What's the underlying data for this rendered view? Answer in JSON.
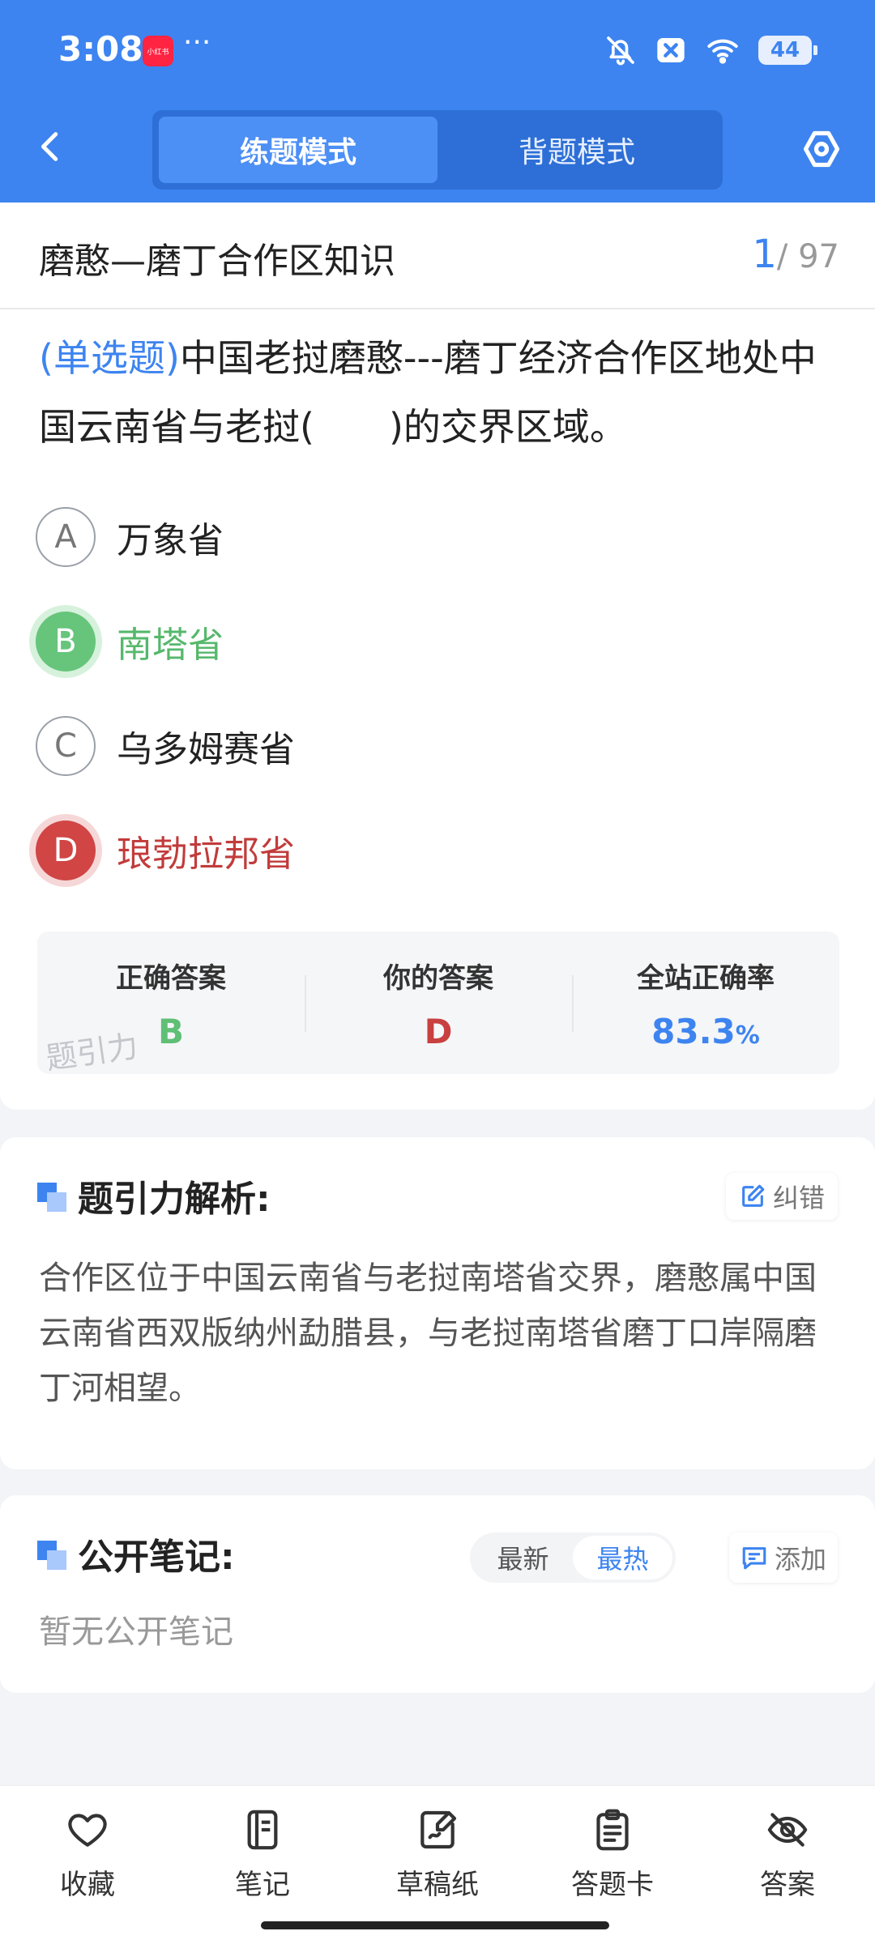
{
  "status": {
    "time": "3:08",
    "app_badge": "小红书",
    "more": "···",
    "battery": "44"
  },
  "header": {
    "tabs": [
      {
        "label": "练题模式",
        "active": true
      },
      {
        "label": "背题模式",
        "active": false
      }
    ]
  },
  "question": {
    "section_title": "磨憨—磨丁合作区知识",
    "progress_current": "1",
    "progress_total": "/ 97",
    "type_label": "(单选题)",
    "text": "中国老挝磨憨---磨丁经济合作区地处中国云南省与老挝(　　)的交界区域。",
    "options": [
      {
        "letter": "A",
        "text": "万象省",
        "state": "normal"
      },
      {
        "letter": "B",
        "text": "南塔省",
        "state": "correct"
      },
      {
        "letter": "C",
        "text": "乌多姆赛省",
        "state": "normal"
      },
      {
        "letter": "D",
        "text": "琅勃拉邦省",
        "state": "wrong"
      }
    ]
  },
  "summary": {
    "correct_label": "正确答案",
    "correct_value": "B",
    "yours_label": "你的答案",
    "yours_value": "D",
    "rate_label": "全站正确率",
    "rate_value": "83.3",
    "rate_unit": "%",
    "watermark": "题引力"
  },
  "analysis": {
    "title": "题引力解析:",
    "report_label": "纠错",
    "text": "合作区位于中国云南省与老挝南塔省交界，磨憨属中国云南省西双版纳州勐腊县，与老挝南塔省磨丁口岸隔磨丁河相望。"
  },
  "notes": {
    "title": "公开笔记:",
    "sort": [
      {
        "label": "最新",
        "active": false
      },
      {
        "label": "最热",
        "active": true
      }
    ],
    "add_label": "添加",
    "empty_text": "暂无公开笔记"
  },
  "bottom_bar": [
    {
      "icon": "heart-icon",
      "label": "收藏"
    },
    {
      "icon": "notebook-icon",
      "label": "笔记"
    },
    {
      "icon": "draft-paper-icon",
      "label": "草稿纸"
    },
    {
      "icon": "answer-sheet-icon",
      "label": "答题卡"
    },
    {
      "icon": "eye-off-icon",
      "label": "答案"
    }
  ],
  "colors": {
    "primary": "#3d84f0",
    "correct": "#66c57b",
    "wrong": "#d14545"
  }
}
